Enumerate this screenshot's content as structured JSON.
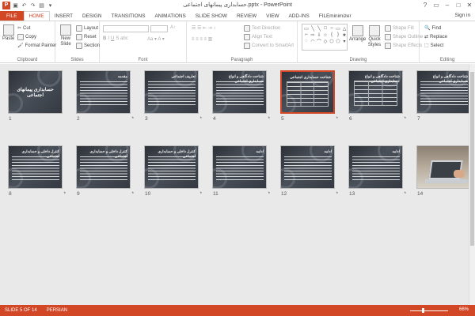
{
  "window": {
    "title": "حسابداری پیمانهای اجتماعی.pptx - PowerPoint",
    "app_icon": "P",
    "controls": [
      "?",
      "▭",
      "–",
      "□",
      "✕"
    ]
  },
  "qat": [
    "save-icon",
    "undo-icon",
    "redo-icon",
    "present-icon",
    "customize-icon"
  ],
  "tabs": [
    {
      "label": "FILE"
    },
    {
      "label": "HOME"
    },
    {
      "label": "INSERT"
    },
    {
      "label": "DESIGN"
    },
    {
      "label": "TRANSITIONS"
    },
    {
      "label": "ANIMATIONS"
    },
    {
      "label": "SLIDE SHOW"
    },
    {
      "label": "REVIEW"
    },
    {
      "label": "VIEW"
    },
    {
      "label": "ADD-INS"
    },
    {
      "label": "FILEminimizer"
    }
  ],
  "signin": "Sign in",
  "ribbon": {
    "clipboard": {
      "paste": "Paste",
      "cut": "Cut",
      "copy": "Copy",
      "format_painter": "Format Painter",
      "label": "Clipboard"
    },
    "slides": {
      "new_slide": "New Slide",
      "layout": "Layout",
      "reset": "Reset",
      "section": "Section",
      "label": "Slides"
    },
    "font": {
      "label": "Font"
    },
    "paragraph": {
      "text_direction": "Text Direction",
      "align_text": "Align Text",
      "convert_smartart": "Convert to SmartArt",
      "label": "Paragraph"
    },
    "drawing": {
      "arrange": "Arrange",
      "quick_styles": "Quick Styles",
      "shape_fill": "Shape Fill",
      "shape_outline": "Shape Outline",
      "shape_effects": "Shape Effects",
      "label": "Drawing"
    },
    "editing": {
      "find": "Find",
      "replace": "Replace",
      "select": "Select",
      "label": "Editing"
    }
  },
  "slides": [
    {
      "number": "1",
      "title": "حسابداری پیمانهای اجتماعی",
      "kind": "title",
      "star": ""
    },
    {
      "number": "2",
      "title": "مقدمه",
      "kind": "text",
      "star": "*"
    },
    {
      "number": "3",
      "title": "تعاریف اجتماعی",
      "kind": "text",
      "star": "*"
    },
    {
      "number": "4",
      "title": "شناخت دادگاهی و انواع حسابداری اجتماعی",
      "kind": "text",
      "star": "*"
    },
    {
      "number": "5",
      "title": "شناخت حسابداری اجتماعی",
      "kind": "table",
      "star": "*"
    },
    {
      "number": "6",
      "title": "شناخت دادگاهی و انواع حسابداری اجتماعی",
      "kind": "table",
      "star": "*"
    },
    {
      "number": "7",
      "title": "شناخت دادگاهی و انواع حسابداری اجتماعی",
      "kind": "text",
      "star": "*"
    },
    {
      "number": "8",
      "title": "کنترل داخلی و حسابداری اجتماعی",
      "kind": "text",
      "star": "*"
    },
    {
      "number": "9",
      "title": "کنترل داخلی و حسابداری اجتماعی",
      "kind": "text",
      "star": "*"
    },
    {
      "number": "10",
      "title": "کنترل داخلی و حسابداری اجتماعی",
      "kind": "text",
      "star": "*"
    },
    {
      "number": "11",
      "title": "ادامه",
      "kind": "text",
      "star": "*"
    },
    {
      "number": "12",
      "title": "ادامه",
      "kind": "text",
      "star": "*"
    },
    {
      "number": "13",
      "title": "ادامه",
      "kind": "text",
      "star": "*"
    },
    {
      "number": "14",
      "title": "",
      "kind": "photo",
      "star": ""
    }
  ],
  "selected_slide": 5,
  "status": {
    "slide_info": "SLIDE 5 OF 14",
    "language": "PERSIAN",
    "zoom": "66%",
    "zoom_level": 0.66
  }
}
